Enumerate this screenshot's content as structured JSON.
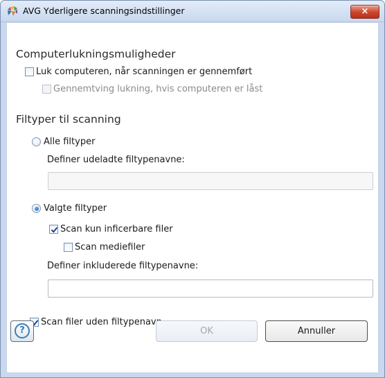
{
  "window": {
    "title": "AVG Yderligere scanningsindstillinger",
    "close_label": "×"
  },
  "shutdown": {
    "heading": "Computerlukningsmuligheder",
    "shutdown_after_scan": {
      "label": "Luk computeren, når scanningen er gennemført",
      "checked": false
    },
    "force_shutdown": {
      "label": "Gennemtving lukning, hvis computeren er låst",
      "checked": false,
      "disabled": true
    }
  },
  "filetypes": {
    "heading": "Filtyper til scanning",
    "all_filetypes": {
      "label": "Alle filtyper",
      "selected": false
    },
    "excluded_extensions": {
      "label": "Definer udeladte filtypenavne:",
      "value": ""
    },
    "selected_filetypes": {
      "label": "Valgte filtyper",
      "selected": true
    },
    "scan_infectable_only": {
      "label": "Scan kun inficerbare filer",
      "checked": true
    },
    "scan_media_files": {
      "label": "Scan mediefiler",
      "checked": false
    },
    "included_extensions": {
      "label": "Definer inkluderede filtypenavne:",
      "value": ""
    },
    "scan_no_extension": {
      "label": "Scan filer uden filtypenavn",
      "checked": true
    }
  },
  "buttons": {
    "help_label": "?",
    "ok_label": "OK",
    "cancel_label": "Annuller"
  }
}
